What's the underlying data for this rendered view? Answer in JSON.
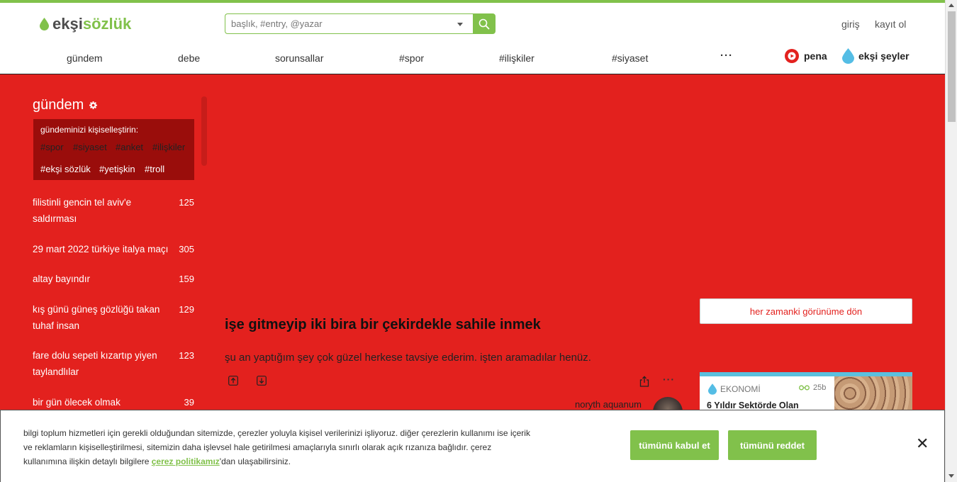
{
  "header": {
    "logo": {
      "part1": "ekşi",
      "part2": "sözlük"
    },
    "search": {
      "placeholder": "başlık, #entry, @yazar"
    },
    "auth": {
      "login": "giriş",
      "register": "kayıt ol"
    },
    "nav": [
      "gündem",
      "debe",
      "sorunsallar",
      "#spor",
      "#ilişkiler",
      "#siyaset"
    ],
    "nav_more": "···",
    "brands": {
      "pena": "pena",
      "eksi_seyler": "ekşi şeyler"
    }
  },
  "sidebar": {
    "title": "gündem",
    "personalize_label": "gündeminizi kişiselleştirin:",
    "tags_off": [
      "#spor",
      "#siyaset",
      "#anket",
      "#ilişkiler"
    ],
    "tags_on": [
      "#ekşi sözlük",
      "#yetişkin",
      "#troll"
    ],
    "topics": [
      {
        "title": "filistinli gencin tel aviv'e saldırması",
        "count": "125"
      },
      {
        "title": "29 mart 2022 türkiye italya maçı",
        "count": "305"
      },
      {
        "title": "altay bayındır",
        "count": "159"
      },
      {
        "title": "kış günü güneş gözlüğü takan tuhaf insan",
        "count": "129"
      },
      {
        "title": "fare dolu sepeti kızartıp yiyen taylandlılar",
        "count": "123"
      },
      {
        "title": "bir gün ölecek olmak",
        "count": "39"
      }
    ]
  },
  "entry": {
    "title": "işe gitmeyip iki bira bir çekirdekle sahile inmek",
    "body": "şu an yaptığım şey çok güzel herkese tavsiye ederim. işten aramadılar henüz.",
    "more": "···",
    "author": "noryth aquanum"
  },
  "right": {
    "classic_view": "her zamanki görünüme dön",
    "card": {
      "category": "EKONOMİ",
      "time": "25b",
      "headline": "6 Yıldır Sektörde Olan"
    }
  },
  "cookie": {
    "text_before": "bilgi toplum hizmetleri için gerekli olduğundan sitemizde, çerezler yoluyla kişisel verilerinizi işliyoruz. diğer çerezlerin kullanımı ise içerik ve reklamların kişiselleştirilmesi, sitemizin daha işlevsel hale getirilmesi amaçlarıyla sınırlı olarak açık rızanıza bağlıdır. çerez kullanımına ilişkin detaylı bilgilere ",
    "link": "çerez politikamız",
    "text_after": "'dan ulaşabilirsiniz.",
    "accept": "tümünü kabul et",
    "reject": "tümünü reddet",
    "close": "✕"
  },
  "colors": {
    "accent": "#81c14b",
    "background": "#e3211e",
    "personalize_bg": "#9a0d0b"
  }
}
